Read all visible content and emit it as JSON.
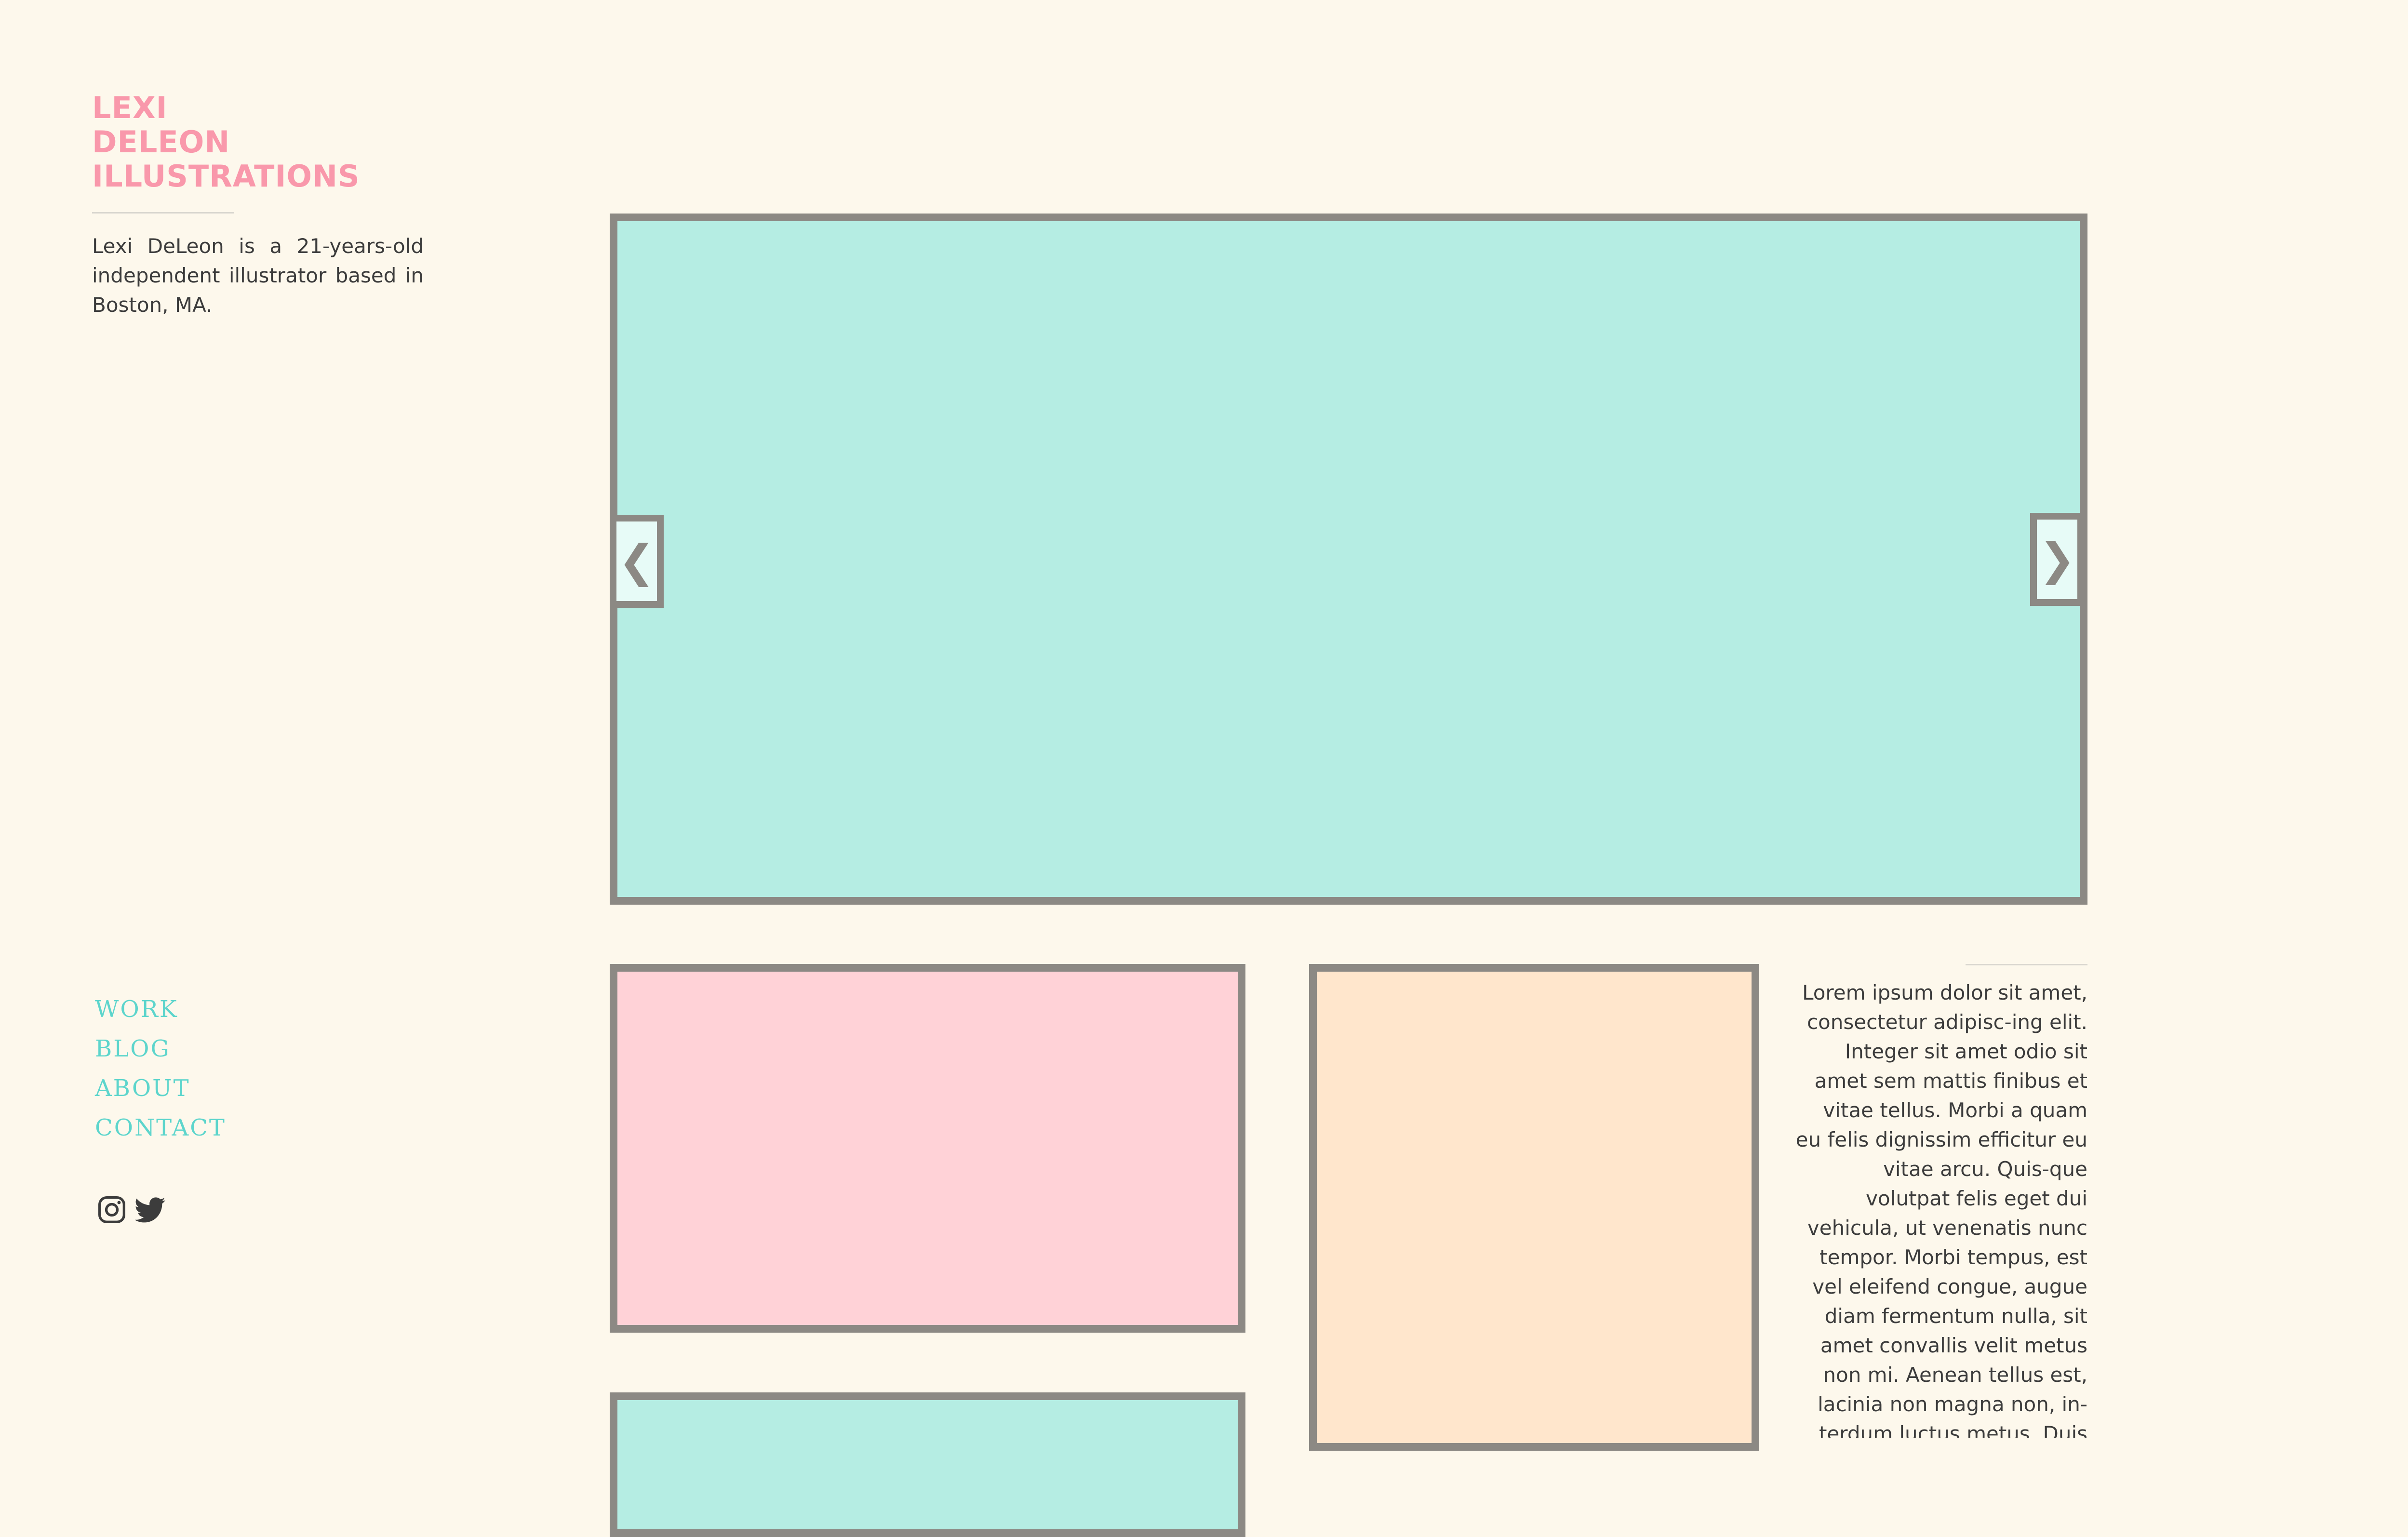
{
  "site": {
    "title_lines": [
      "LEXI",
      "DELEON",
      "ILLUSTRATIONS"
    ],
    "bio": "Lexi DeLeon is a 21-years-old independent illustrator based in Boston, MA."
  },
  "nav": {
    "items": [
      "WORK",
      "BLOG",
      "ABOUT",
      "CONTACT"
    ]
  },
  "social": {
    "icons": [
      "instagram-icon",
      "twitter-icon"
    ]
  },
  "slider": {
    "prev_glyph": "❮",
    "next_glyph": "❯",
    "slide_color": "#b5ede3"
  },
  "gallery": {
    "tile_colors": [
      "#ffd2d7",
      "#ffe6cc",
      "#b5ede3"
    ]
  },
  "article": {
    "text": "Lorem ipsum dolor sit amet, consectetur adipisc-ing elit. Integer sit amet odio sit amet sem mattis finibus et vitae tellus. Morbi a quam eu felis dignissim efficitur eu vitae arcu. Quis-que volutpat felis eget dui vehicula, ut venenatis nunc tempor. Morbi tempus, est vel eleifend congue, augue diam fermentum nulla, sit amet convallis velit metus non mi. Aenean tellus est, lacinia non magna non, in-terdum luctus metus. Duis"
  },
  "colors": {
    "background": "#fdf8ec",
    "brand_pink": "#f998ab",
    "nav_teal": "#5dd5cc",
    "frame_gray": "#8c8984",
    "text": "#3c3c3c"
  }
}
